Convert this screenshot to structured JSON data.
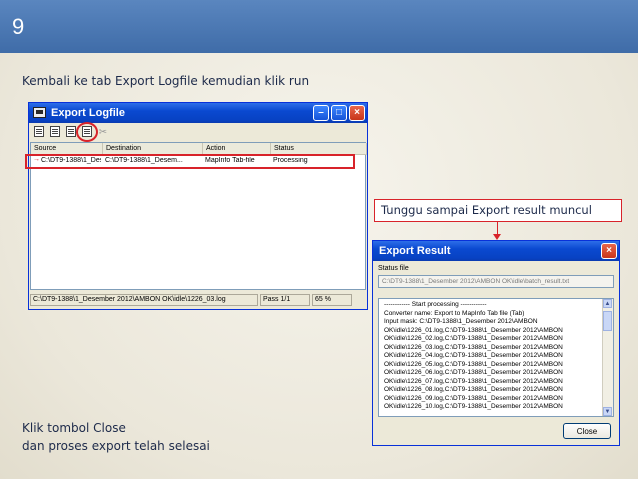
{
  "slide": {
    "number": "9",
    "instruction_top": "Kembali ke tab Export Logfile kemudian klik run",
    "callout_text": "Tunggu sampai Export result muncul",
    "instruction_bottom_line1": "Klik tombol Close",
    "instruction_bottom_line2": "dan proses export telah selesai",
    "colors": {
      "header": "#3f6ca8",
      "highlight": "#d8232a",
      "xp_title": "#0a49d0"
    }
  },
  "export_logfile": {
    "title": "Export Logfile",
    "toolbar_icons": [
      "add-file-icon",
      "add-folder-icon",
      "remove-icon",
      "run-icon",
      "settings-icon"
    ],
    "columns": [
      "Source",
      "Destination",
      "Action",
      "Status"
    ],
    "rows": [
      {
        "source": "C:\\DT9-1388\\1_Dese...",
        "destination": "C:\\DT9-1388\\1_Desem...",
        "action": "MapInfo Tab-file",
        "status": "Processing"
      }
    ],
    "statusbar": {
      "path": "C:\\DT9-1388\\1_Desember 2012\\AMBON OK\\idle\\1226_03.log",
      "pass": "Pass 1/1",
      "percent": "65 %"
    }
  },
  "export_result": {
    "title": "Export Result",
    "status_file_label": "Status file",
    "status_file_value": "C:\\DT9-1388\\1_Desember 2012\\AMBON OK\\idle\\batch_result.txt",
    "log_lines": [
      "------------ Start processing ------------",
      "Converter name: Export to MapInfo Tab file (Tab)",
      "Input mask: C:\\DT9-1388\\1_Desember 2012\\AMBON",
      "OK\\idle\\1226_01.log,C:\\DT9-1388\\1_Desember 2012\\AMBON",
      "OK\\idle\\1226_02.log,C:\\DT9-1388\\1_Desember 2012\\AMBON",
      "OK\\idle\\1226_03.log,C:\\DT9-1388\\1_Desember 2012\\AMBON",
      "OK\\idle\\1226_04.log,C:\\DT9-1388\\1_Desember 2012\\AMBON",
      "OK\\idle\\1226_05.log,C:\\DT9-1388\\1_Desember 2012\\AMBON",
      "OK\\idle\\1226_06.log,C:\\DT9-1388\\1_Desember 2012\\AMBON",
      "OK\\idle\\1226_07.log,C:\\DT9-1388\\1_Desember 2012\\AMBON",
      "OK\\idle\\1226_08.log,C:\\DT9-1388\\1_Desember 2012\\AMBON",
      "OK\\idle\\1226_09.log,C:\\DT9-1388\\1_Desember 2012\\AMBON",
      "OK\\idle\\1226_10.log,C:\\DT9-1388\\1_Desember 2012\\AMBON"
    ],
    "close_label": "Close"
  }
}
